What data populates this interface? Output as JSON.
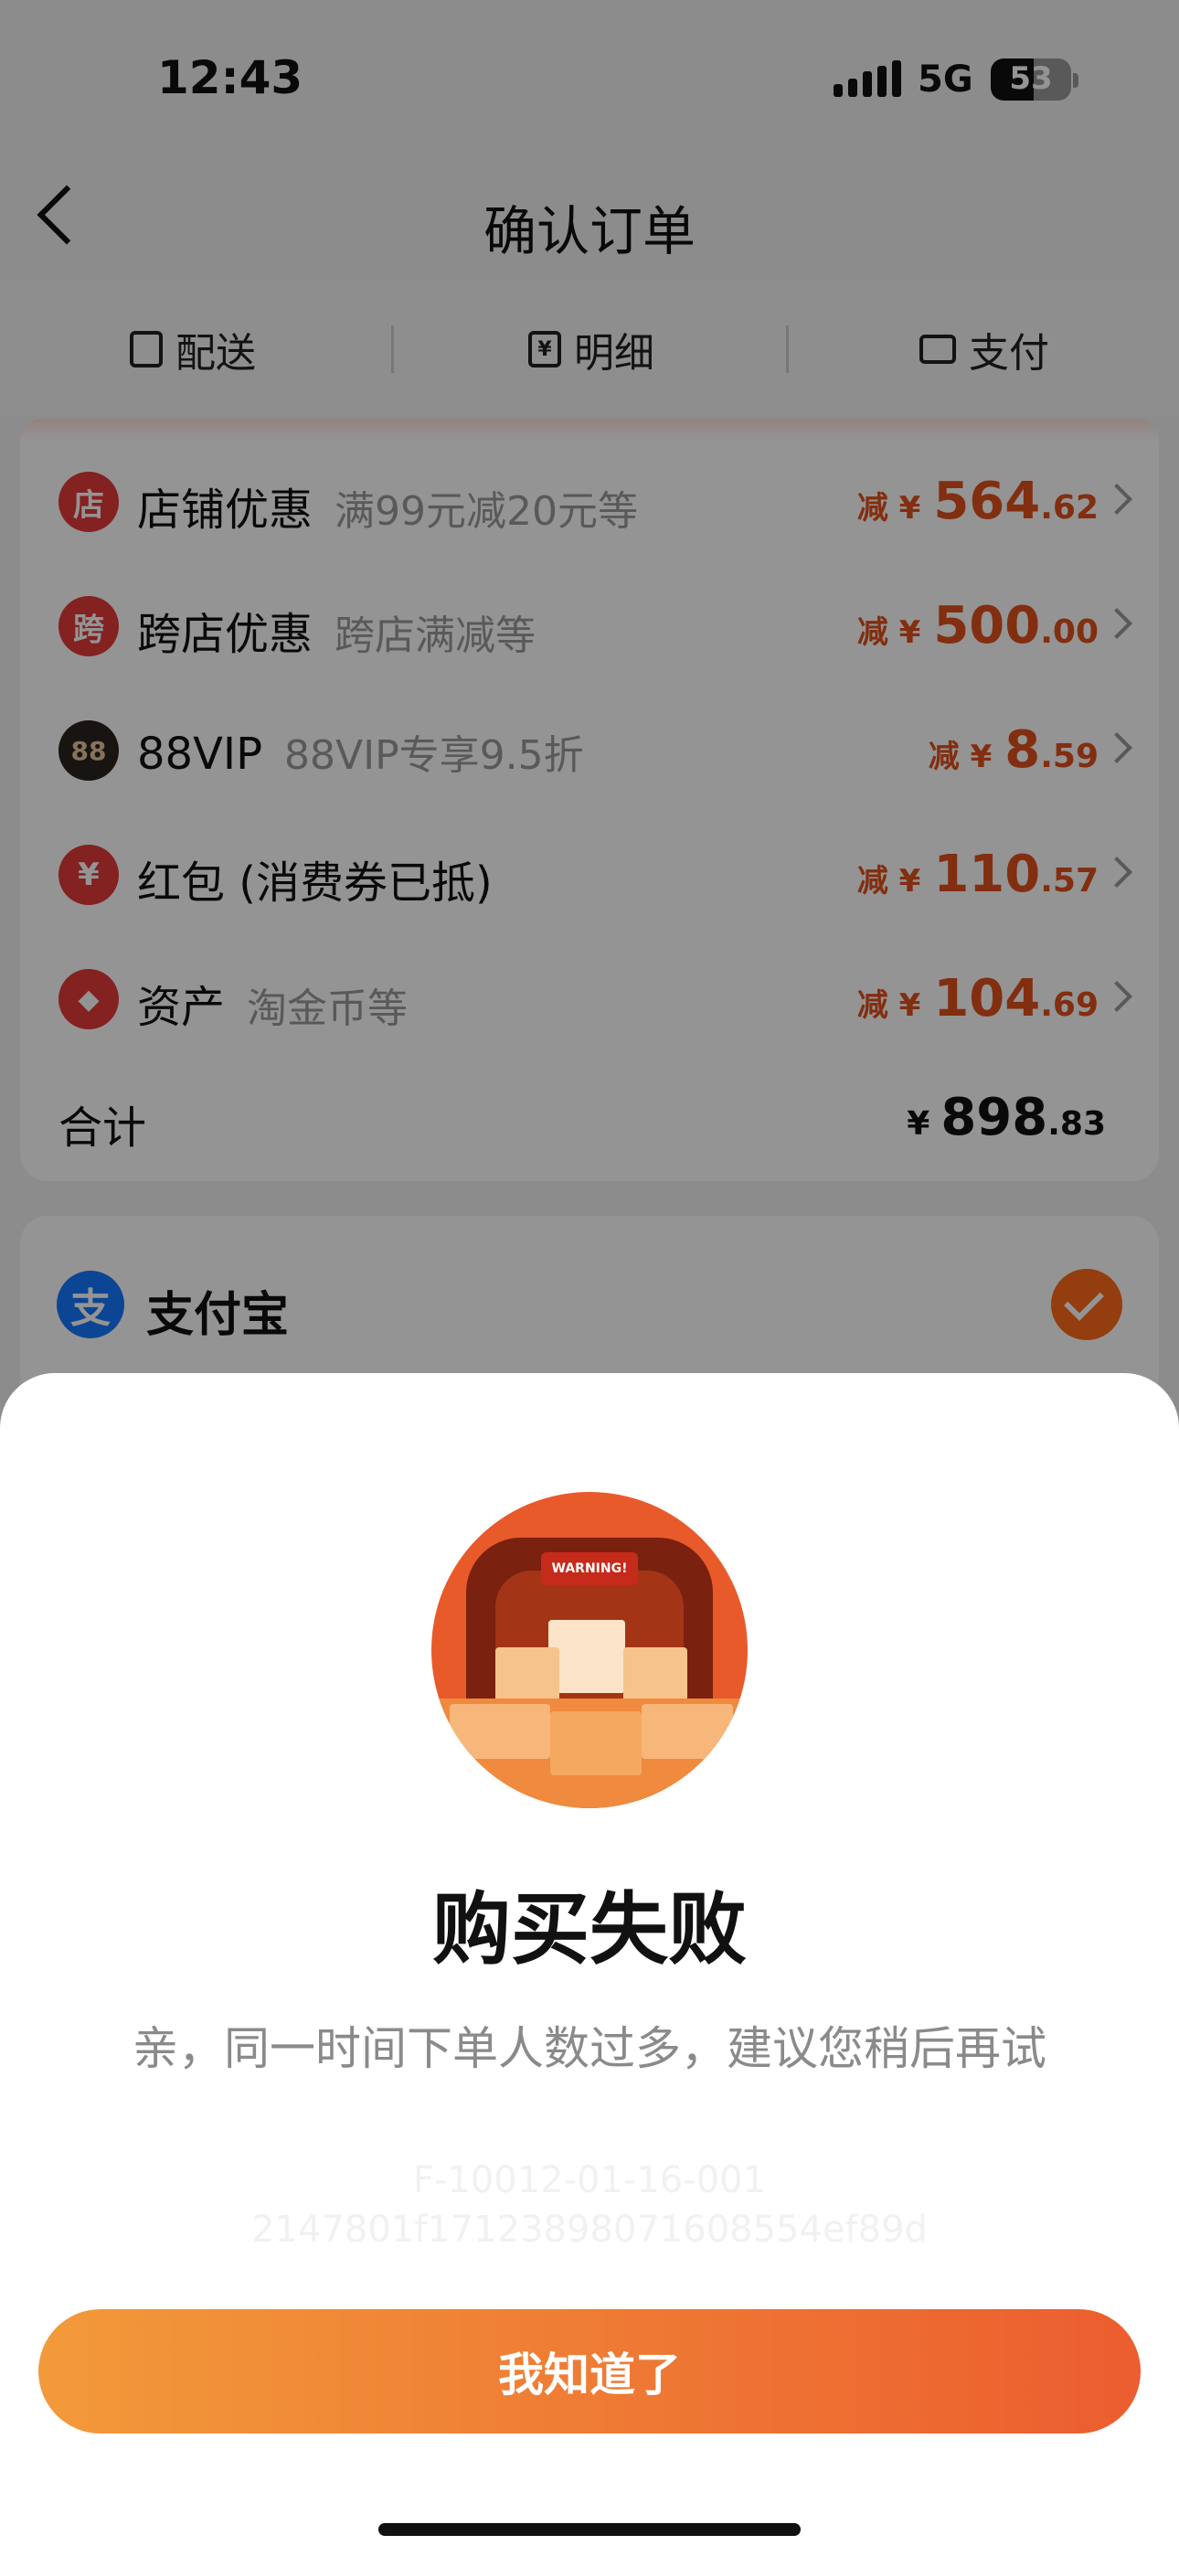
{
  "status_bar": {
    "time": "12:43",
    "network": "5G",
    "battery": "53",
    "battery_level": 0.53
  },
  "header": {
    "title": "确认订单"
  },
  "tabs": [
    {
      "label": "配送",
      "icon": "package-icon"
    },
    {
      "label": "明细",
      "icon": "yuan-receipt-icon",
      "glyph": "¥"
    },
    {
      "label": "支付",
      "icon": "wallet-icon"
    }
  ],
  "discounts": [
    {
      "icon": "shop-icon",
      "glyph": "店",
      "color": "#e43a3a",
      "name": "店铺优惠",
      "sub": "满99元减20元等",
      "prefix": "减 ¥",
      "int": "564",
      "dec": ".62"
    },
    {
      "icon": "cross-store-icon",
      "glyph": "跨",
      "color": "#e43a3a",
      "name": "跨店优惠",
      "sub": "跨店满减等",
      "prefix": "减 ¥",
      "int": "500",
      "dec": ".00"
    },
    {
      "icon": "vip-88-icon",
      "glyph": "88",
      "color": "#2a2420",
      "name": "88VIP",
      "sub": "88VIP专享9.5折",
      "prefix": "减 ¥",
      "int": "8",
      "dec": ".59"
    },
    {
      "icon": "red-packet-icon",
      "glyph": "¥",
      "color": "#e43a3a",
      "name": "红包 (消费券已抵)",
      "sub": "",
      "prefix": "减 ¥",
      "int": "110",
      "dec": ".57"
    },
    {
      "icon": "tag-icon",
      "glyph": "◆",
      "color": "#e43a3a",
      "name": "资产",
      "sub": "淘金币等",
      "prefix": "减 ¥",
      "int": "104",
      "dec": ".69"
    }
  ],
  "total": {
    "label": "合计",
    "prefix": "¥",
    "int": "898",
    "dec": ".83"
  },
  "payment": {
    "glyph": "支",
    "name": "支付宝"
  },
  "dialog": {
    "illustration_text": "WARNING!",
    "title": "购买失败",
    "message": "亲，同一时间下单人数过多，建议您稍后再试",
    "code_line1": "F-10012-01-16-001",
    "code_line2": "2147801f1712389807160855​4ef89d",
    "button": "我知道了"
  }
}
